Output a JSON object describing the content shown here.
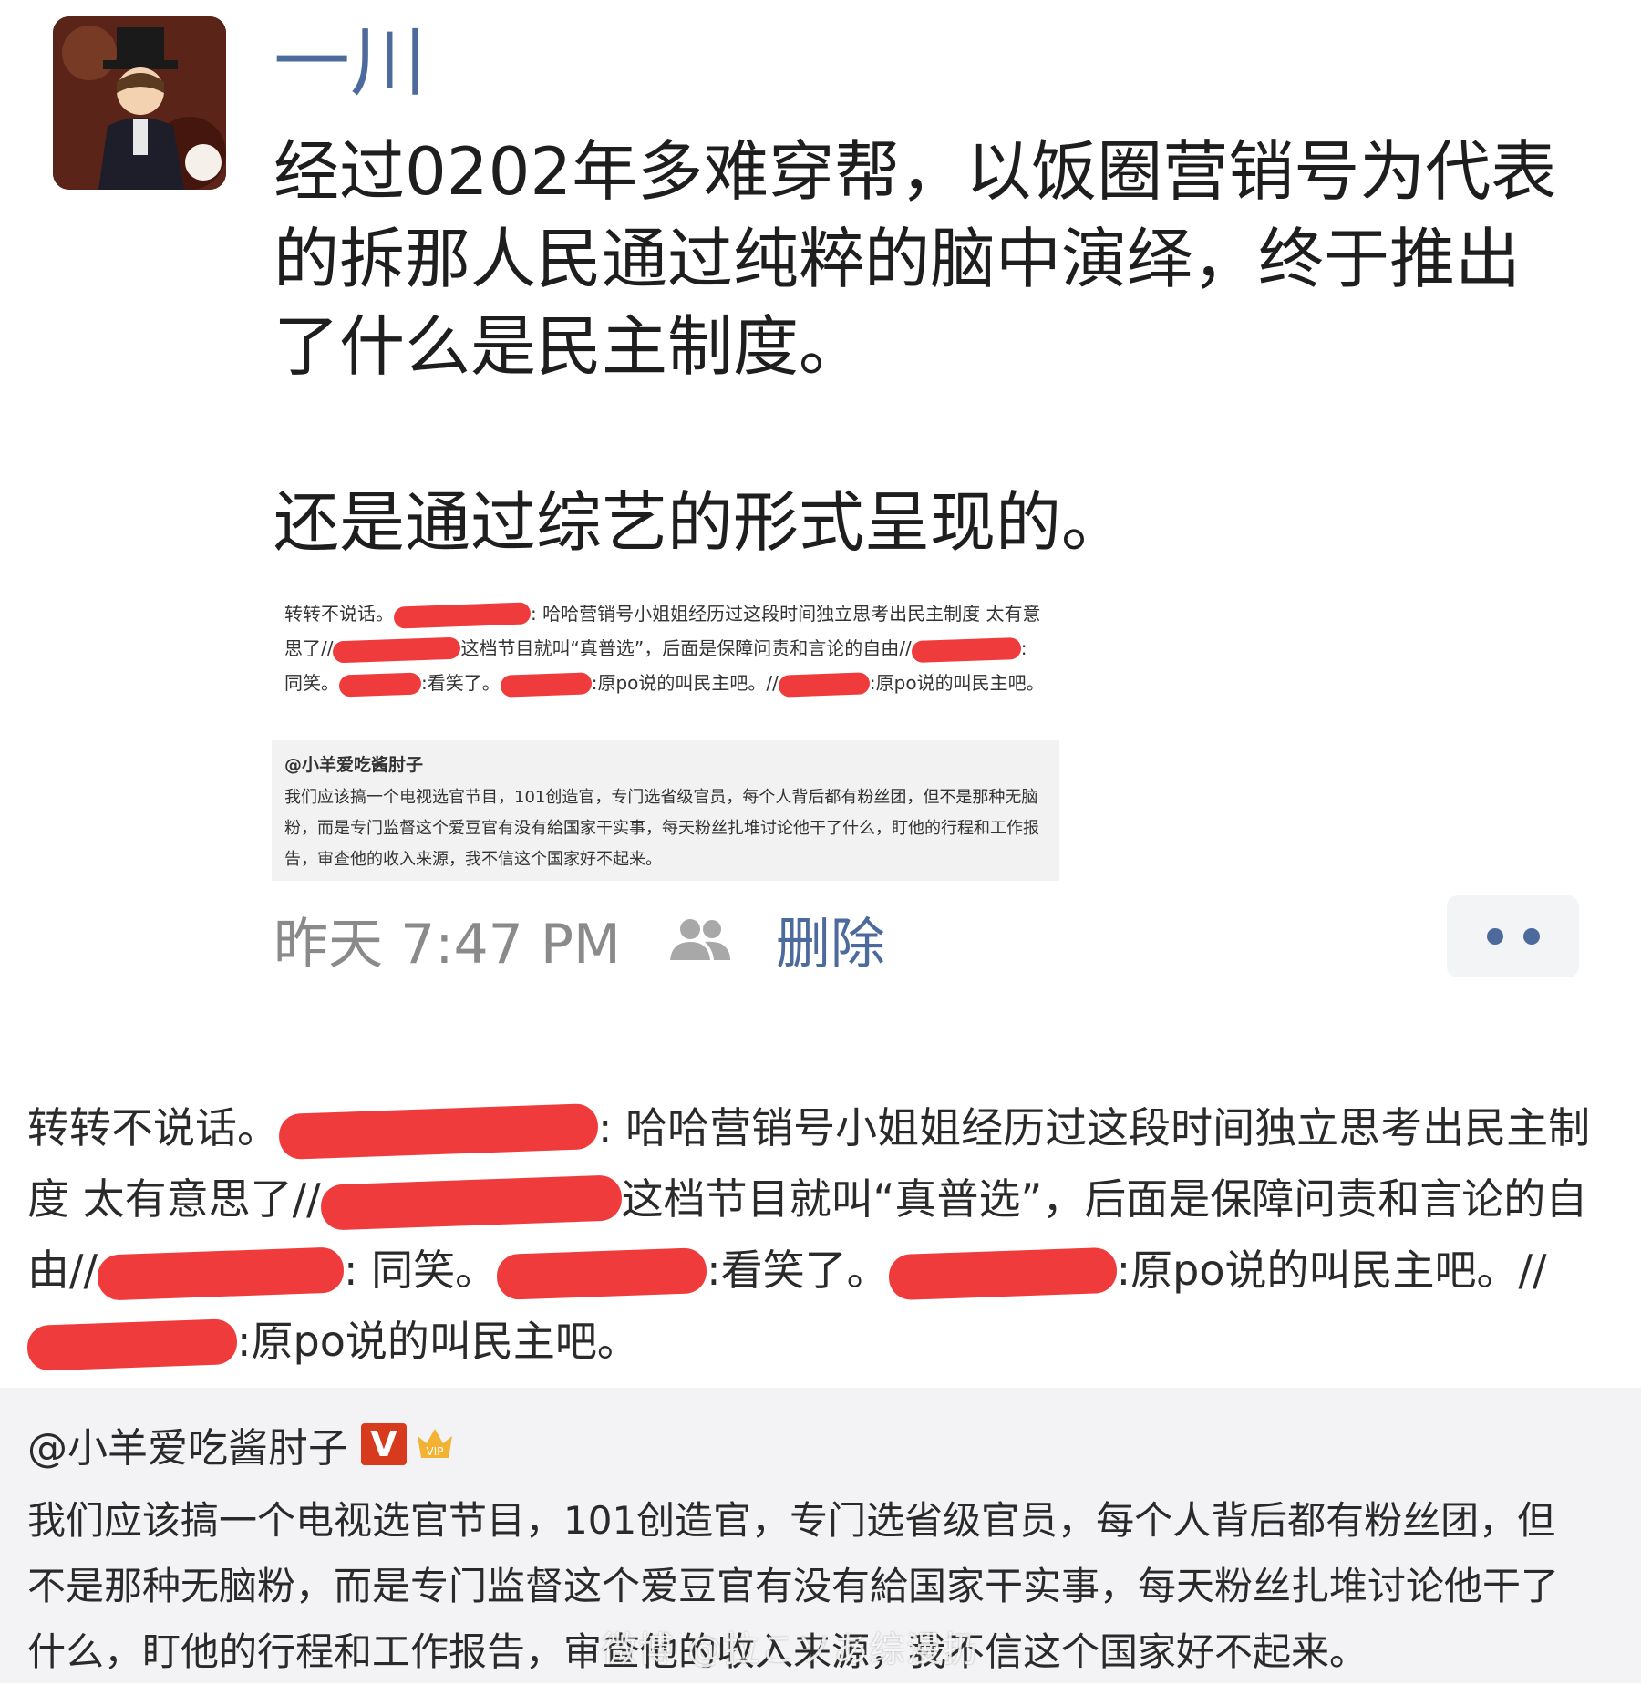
{
  "post": {
    "username": "一川",
    "text_line1": "经过0202年多难穿帮，以饭圈营销号为代表的拆那人民通过纯粹的脑中演绎，终于推出了什么是民主制度。",
    "text_line2": "还是通过综艺的形式呈现的。",
    "timestamp": "昨天 7:47 PM",
    "delete_label": "删除"
  },
  "repost_chain": {
    "p1": "转转不说话。",
    "p2": ": 哈哈营销号小姐姐经历过这段时间独立思考出民主制度 太有意思了//",
    "p3": "这档节目就叫“真普选”，后面是保障问责和言论的自由//",
    "p4": ": 同笑。",
    "p5": ":看笑了。",
    "p6": ":原po说的叫民主吧。//",
    "p7": ":原po说的叫民主吧。"
  },
  "quoted_post": {
    "author": "@小羊爱吃酱肘子",
    "v_badge": "V",
    "vip_badge": "VIP",
    "text": "我们应该搞一个电视选官节目，101创造官，专门选省级官员，每个人背后都有粉丝团，但不是那种无脑粉，而是专门监督这个爱豆官有没有給国家干实事，每天粉丝扎堆讨论他干了什么，盯他的行程和工作报告，审查他的收入来源，我不信这个国家好不起来。"
  },
  "watermark": "微博 @拉こソあ综漫扔",
  "colors": {
    "link": "#4d6a9c",
    "redaction": "#ef3b3b",
    "quote_bg": "#f3f3f5"
  },
  "icons": {
    "visibility": "people-icon",
    "more": "more-dots-icon"
  }
}
